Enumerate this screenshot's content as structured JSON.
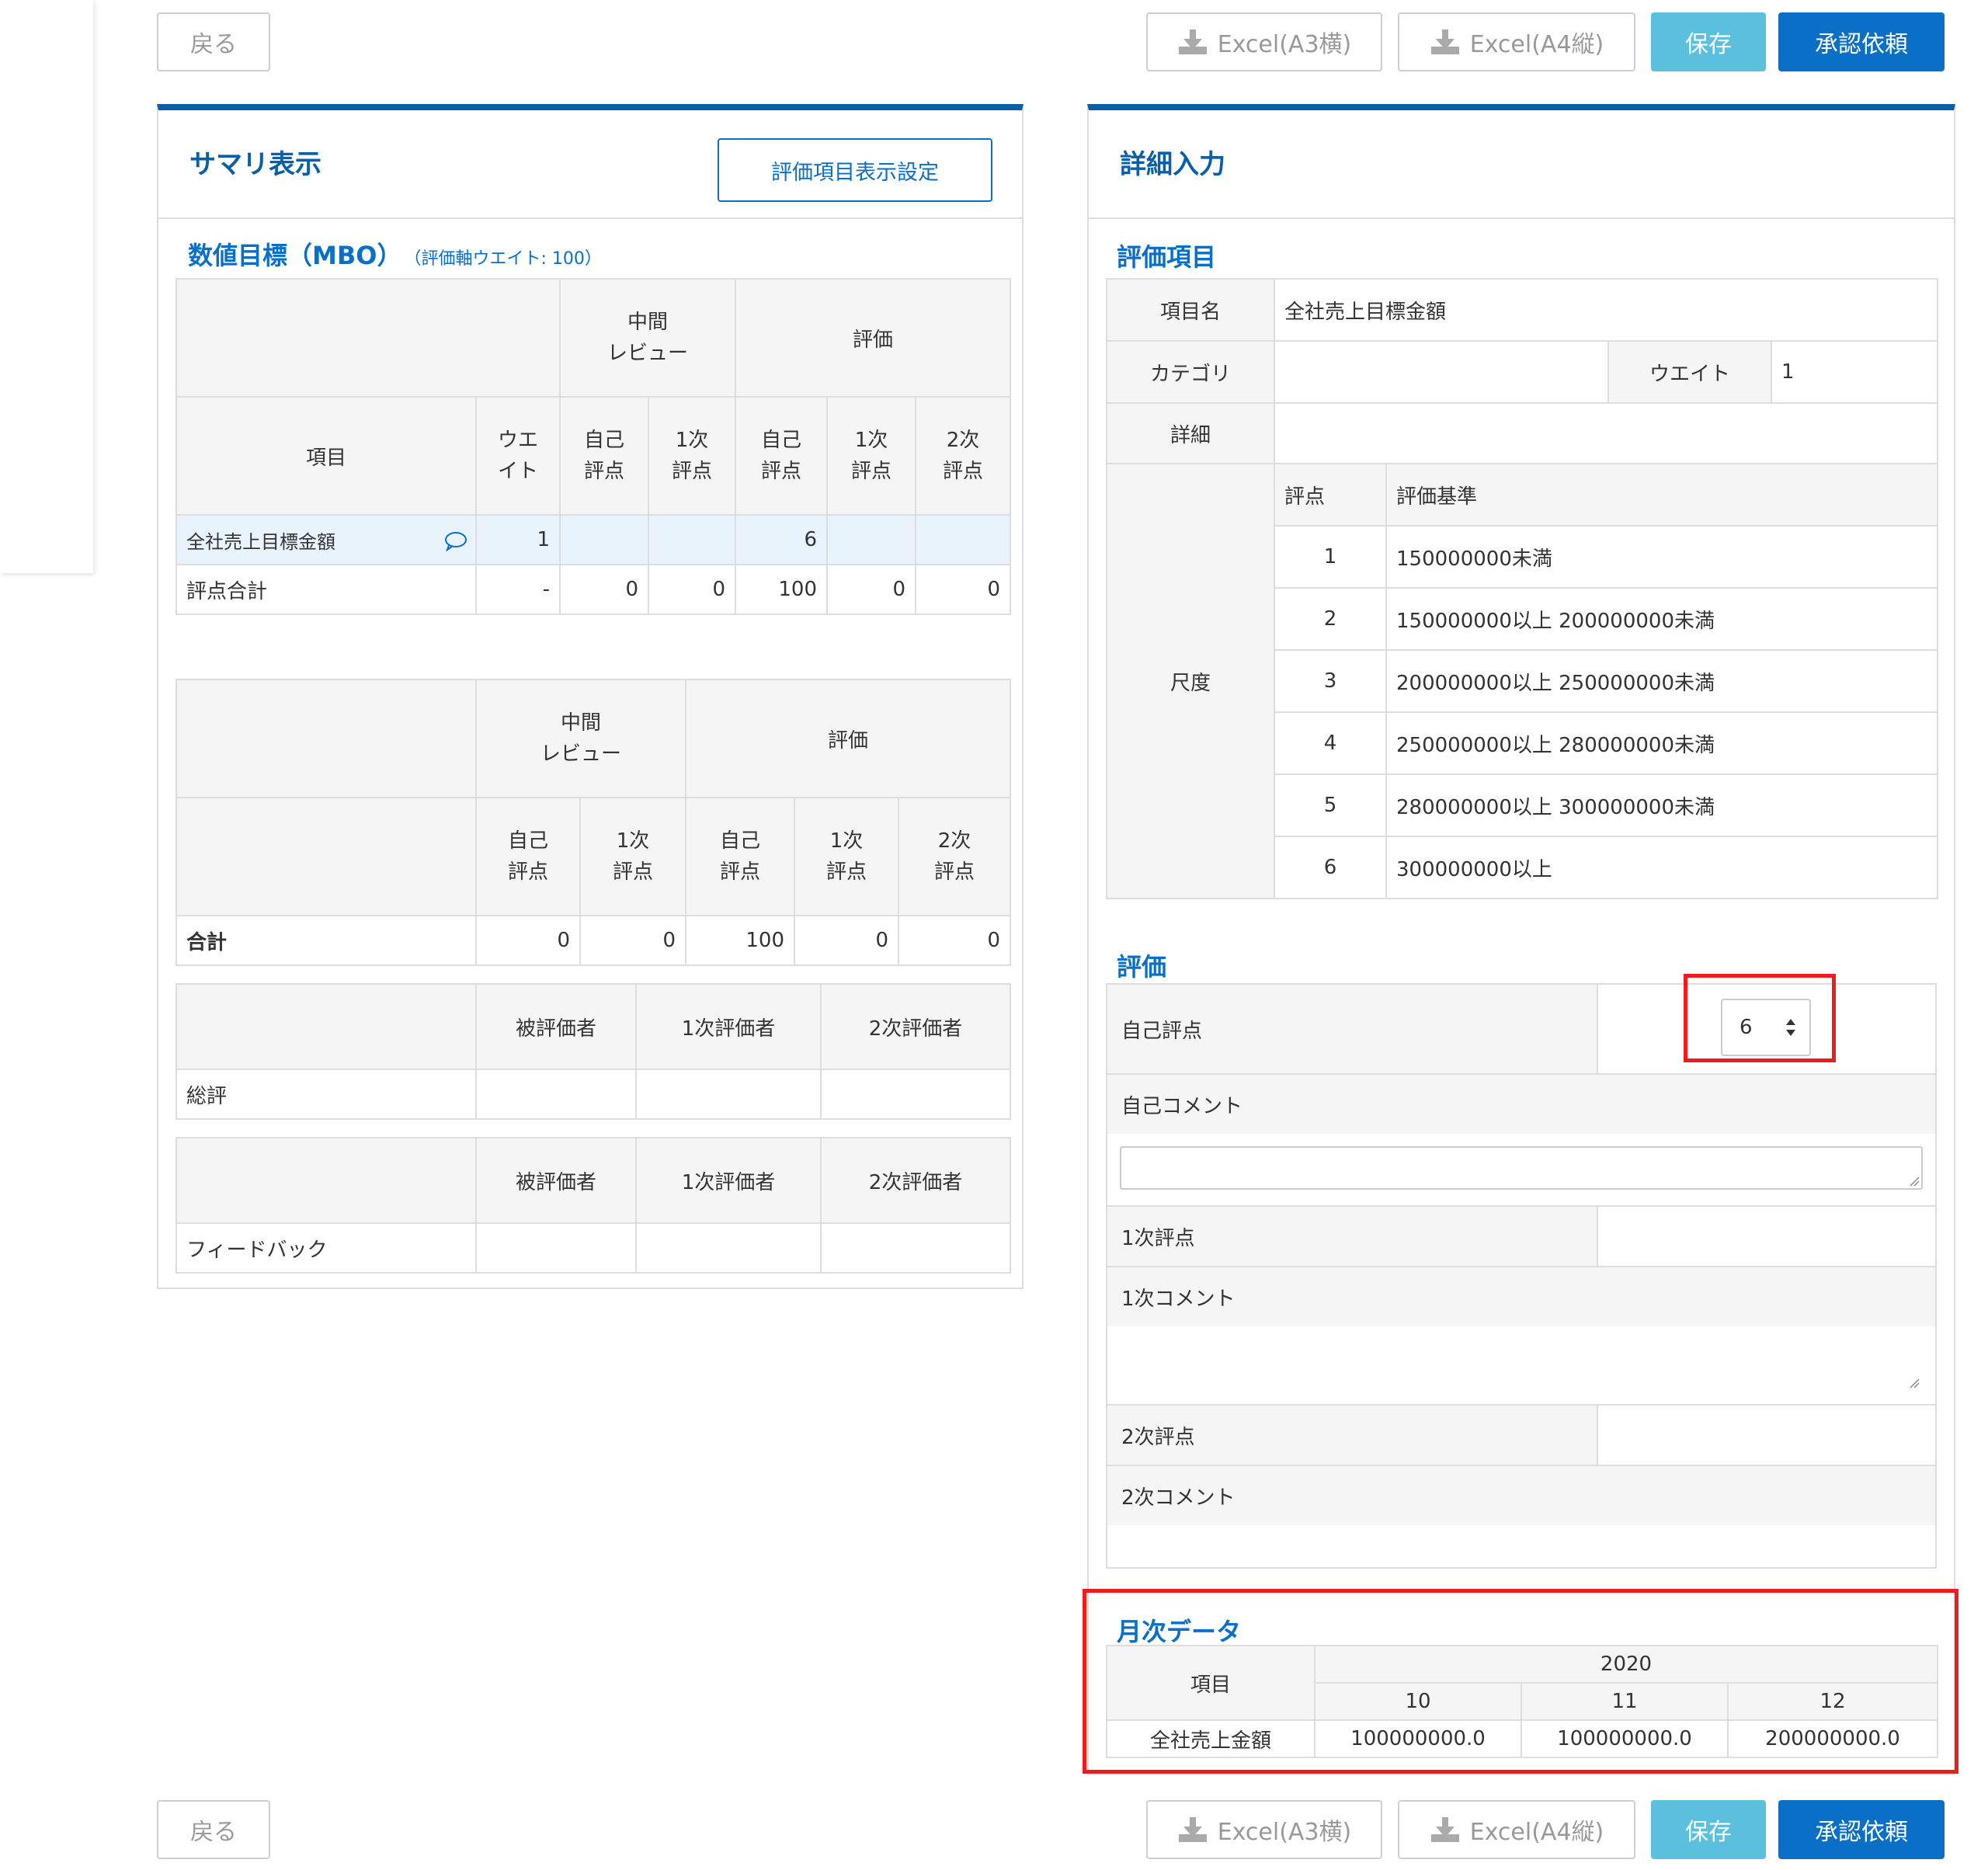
{
  "buttons": {
    "back": "戻る",
    "excel_a3": "Excel(A3横)",
    "excel_a4": "Excel(A4縦)",
    "save": "保存",
    "approval": "承認依頼"
  },
  "summary": {
    "title": "サマリ表示",
    "settings_button": "評価項目表示設定",
    "mbo_title": "数値目標（MBO）",
    "mbo_sub": "（評価軸ウエイト: 100）",
    "table1": {
      "h_mid": "中間\nレビュー",
      "h_eval": "評価",
      "h_item": "項目",
      "h_weight": "ウエ\nイト",
      "h_self": "自己\n評点",
      "h_first": "1次\n評点",
      "h_second": "2次\n評点",
      "row1": {
        "name": "全社売上目標金額",
        "weight": "1",
        "mid_self": "",
        "mid_first": "",
        "ev_self": "6",
        "ev_first": "",
        "ev_second": ""
      },
      "row2": {
        "name": "評点合計",
        "weight": "-",
        "mid_self": "0",
        "mid_first": "0",
        "ev_self": "100",
        "ev_first": "0",
        "ev_second": "0"
      }
    },
    "table2": {
      "h_mid": "中間\nレビュー",
      "h_eval": "評価",
      "h_self": "自己\n評点",
      "h_first": "1次\n評点",
      "h_second": "2次\n評点",
      "total_label": "合計",
      "values": [
        "0",
        "0",
        "100",
        "0",
        "0"
      ]
    },
    "table3": {
      "h_evaluatee": "被評価者",
      "h_first": "1次評価者",
      "h_second": "2次評価者",
      "row_label": "総評"
    },
    "table4": {
      "h_evaluatee": "被評価者",
      "h_first": "1次評価者",
      "h_second": "2次評価者",
      "row_label": "フィードバック"
    }
  },
  "detail": {
    "title": "詳細入力",
    "item_section": "評価項目",
    "item_name_label": "項目名",
    "item_name": "全社売上目標金額",
    "category_label": "カテゴリ",
    "category": "",
    "weight_label": "ウエイト",
    "weight": "1",
    "detail_label": "詳細",
    "detail": "",
    "scale_label": "尺度",
    "scale_h_score": "評点",
    "scale_h_criteria": "評価基準",
    "scale": [
      {
        "score": "1",
        "criteria": "150000000未満"
      },
      {
        "score": "2",
        "criteria": "150000000以上 200000000未満"
      },
      {
        "score": "3",
        "criteria": "200000000以上 250000000未満"
      },
      {
        "score": "4",
        "criteria": "250000000以上 280000000未満"
      },
      {
        "score": "5",
        "criteria": "280000000以上 300000000未満"
      },
      {
        "score": "6",
        "criteria": "300000000以上"
      }
    ],
    "eval_section": "評価",
    "self_score_label": "自己評点",
    "self_score_value": "6",
    "self_comment_label": "自己コメント",
    "first_score_label": "1次評点",
    "first_comment_label": "1次コメント",
    "second_score_label": "2次評点",
    "second_comment_label": "2次コメント",
    "monthly_section": "月次データ",
    "monthly": {
      "h_item": "項目",
      "year": "2020",
      "months": [
        "10",
        "11",
        "12"
      ],
      "row_label": "全社売上金額",
      "values": [
        "100000000.0",
        "100000000.0",
        "200000000.0"
      ]
    }
  },
  "colors": {
    "accent": "#0a5fa8",
    "primary_button": "#0a6fc6",
    "save_button": "#5bc0de",
    "highlight_box": "#ee1c1c"
  }
}
